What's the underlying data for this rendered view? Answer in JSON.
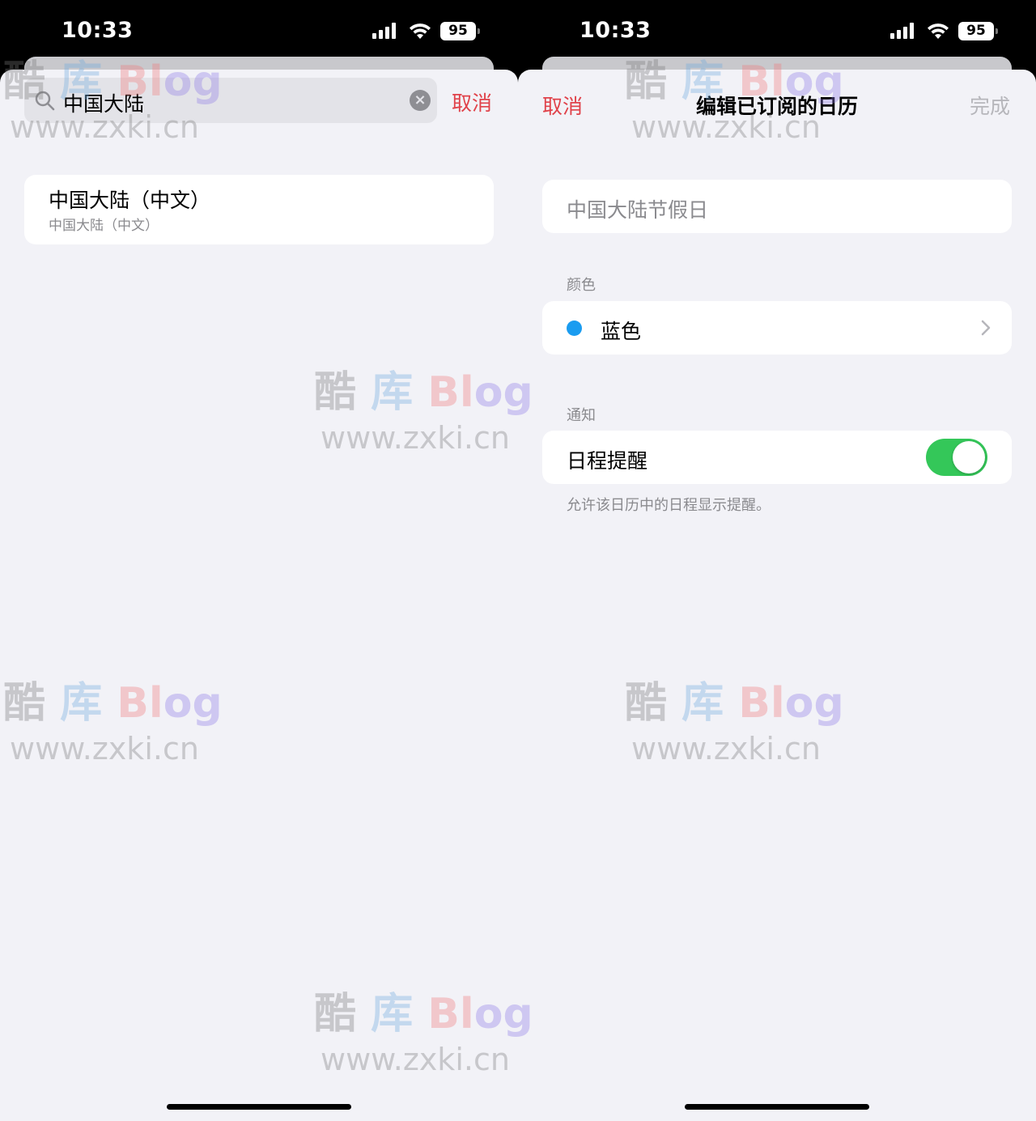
{
  "status": {
    "time": "10:33",
    "battery": "95"
  },
  "left_screen": {
    "search": {
      "value": "中国大陆",
      "cancel_label": "取消"
    },
    "result": {
      "title": "中国大陆（中文）",
      "subtitle": "中国大陆（中文）"
    }
  },
  "right_screen": {
    "nav": {
      "cancel_label": "取消",
      "title": "编辑已订阅的日历",
      "done_label": "完成"
    },
    "calendar_name": "中国大陆节假日",
    "color_section": {
      "label": "颜色",
      "value": "蓝色",
      "color": "#1a9cf0"
    },
    "notify_section": {
      "label": "通知",
      "row_label": "日程提醒",
      "toggle_on": true,
      "footnote": "允许该日历中的日程显示提醒。"
    }
  },
  "watermark": {
    "line1_a": "酷",
    "line1_b": "库",
    "line1_c": "Bl",
    "line1_d": "og",
    "line2": "www.zxki.cn"
  },
  "colors": {
    "accent": "#e0424a",
    "toggle_on": "#34c759",
    "background": "#f2f2f7"
  }
}
